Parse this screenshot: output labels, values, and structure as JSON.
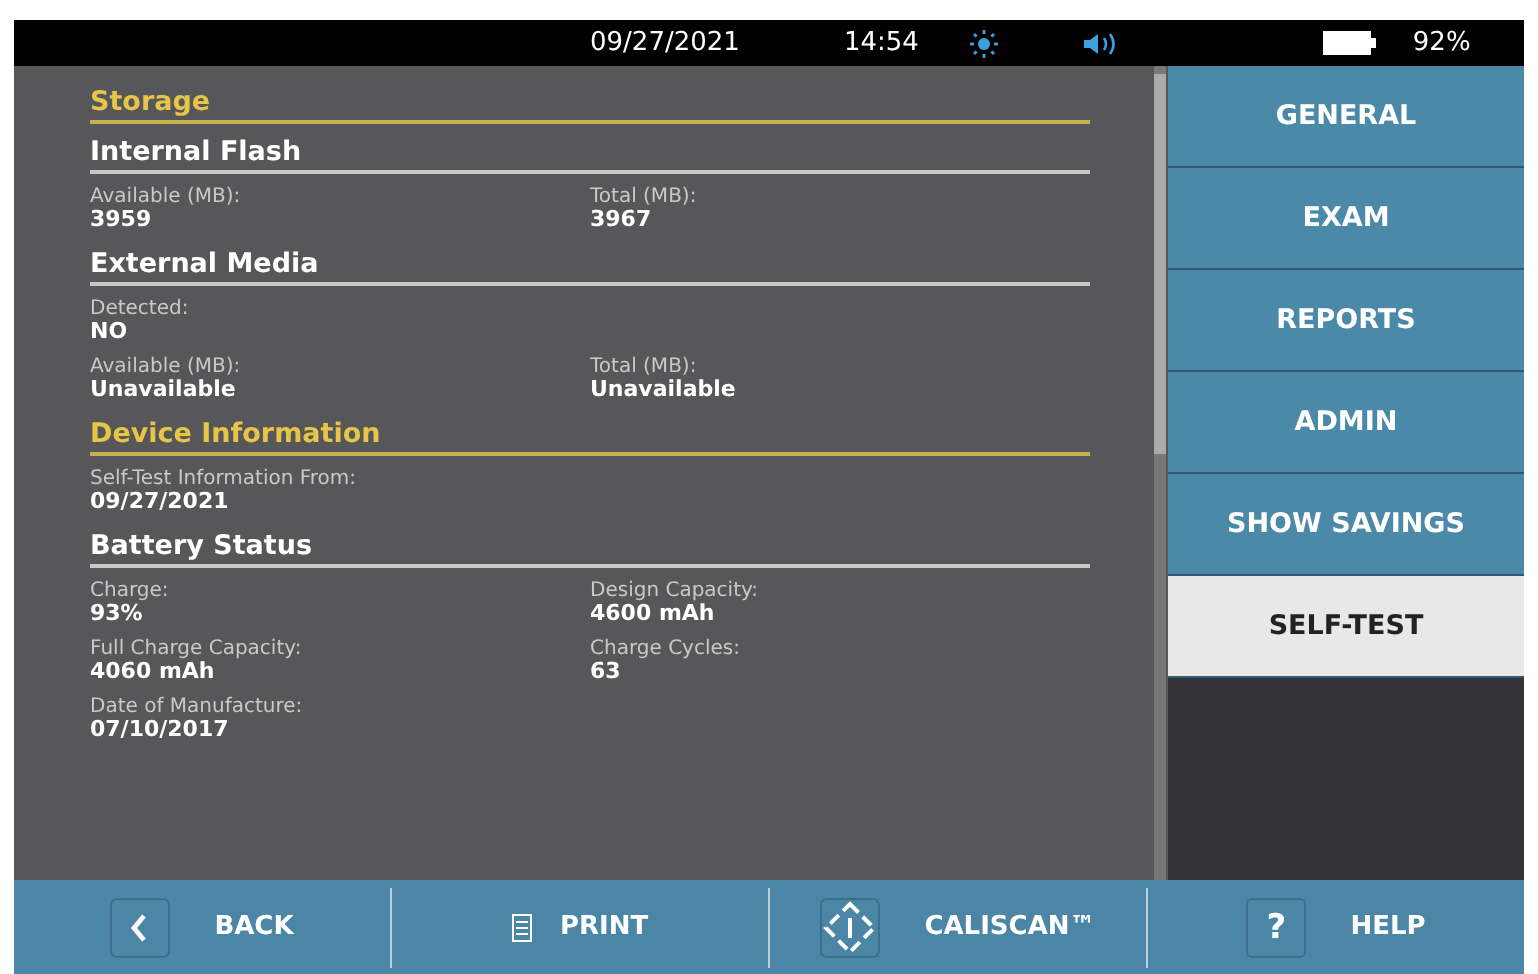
{
  "status_bar": {
    "date": "09/27/2021",
    "time": "14:54",
    "battery": "92%"
  },
  "blocks": [
    {
      "kind": "section",
      "title": "Storage"
    },
    {
      "kind": "subsection",
      "title": "Internal Flash"
    },
    {
      "kind": "fields",
      "rows": [
        [
          {
            "label": "Available (MB):",
            "value": "3959"
          },
          {
            "label": "Total (MB):",
            "value": "3967"
          }
        ]
      ]
    },
    {
      "kind": "subsection",
      "title": "External Media"
    },
    {
      "kind": "fields",
      "rows": [
        [
          {
            "label": "Detected:",
            "value": "NO"
          }
        ],
        [
          {
            "label": "Available (MB):",
            "value": "Unavailable"
          },
          {
            "label": "Total (MB):",
            "value": "Unavailable"
          }
        ]
      ]
    },
    {
      "kind": "section",
      "title": "Device Information"
    },
    {
      "kind": "fields",
      "rows": [
        [
          {
            "label": "Self-Test Information From:",
            "value": "09/27/2021"
          }
        ]
      ]
    },
    {
      "kind": "subsection",
      "title": "Battery Status"
    },
    {
      "kind": "fields",
      "rows": [
        [
          {
            "label": "Charge:",
            "value": "93%"
          },
          {
            "label": "Design Capacity:",
            "value": "4600 mAh"
          }
        ],
        [
          {
            "label": "Full Charge Capacity:",
            "value": "4060 mAh"
          },
          {
            "label": "Charge Cycles:",
            "value": "63"
          }
        ],
        [
          {
            "label": "Date of Manufacture:",
            "value": "07/10/2017"
          }
        ]
      ]
    }
  ],
  "menu": [
    {
      "label": "GENERAL",
      "selected": false
    },
    {
      "label": "EXAM",
      "selected": false
    },
    {
      "label": "REPORTS",
      "selected": false
    },
    {
      "label": "ADMIN",
      "selected": false
    },
    {
      "label": "SHOW SAVINGS",
      "selected": false
    },
    {
      "label": "SELF-TEST",
      "selected": true
    }
  ],
  "toolbar": [
    {
      "kind": "back",
      "label": "BACK"
    },
    {
      "kind": "print",
      "label": "PRINT"
    },
    {
      "kind": "caliscan",
      "label": "CALISCAN™"
    },
    {
      "kind": "help",
      "label": "HELP",
      "icon_text": "?"
    }
  ]
}
